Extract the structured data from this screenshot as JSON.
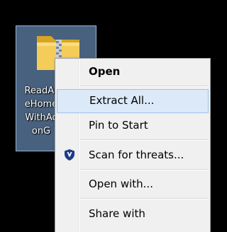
{
  "desktop_icon": {
    "label_lines": [
      "ReadAr",
      "eHome",
      "WithAc",
      "onG"
    ],
    "icon": "zip-folder-icon"
  },
  "context_menu": {
    "items": [
      {
        "label": "Open",
        "bold": true
      },
      {
        "label": "Extract All...",
        "highlighted": true
      },
      {
        "label": "Pin to Start"
      },
      {
        "label": "Scan for threats...",
        "icon": "shield-icon"
      },
      {
        "label": "Open with..."
      },
      {
        "label": "Share with"
      }
    ]
  },
  "colors": {
    "desktop_background": "#000000",
    "selection_tile": "#84b0e6",
    "menu_background": "#f0f0f0",
    "menu_highlight": "#dbe9f8",
    "shield_blue": "#1d3a8c"
  }
}
